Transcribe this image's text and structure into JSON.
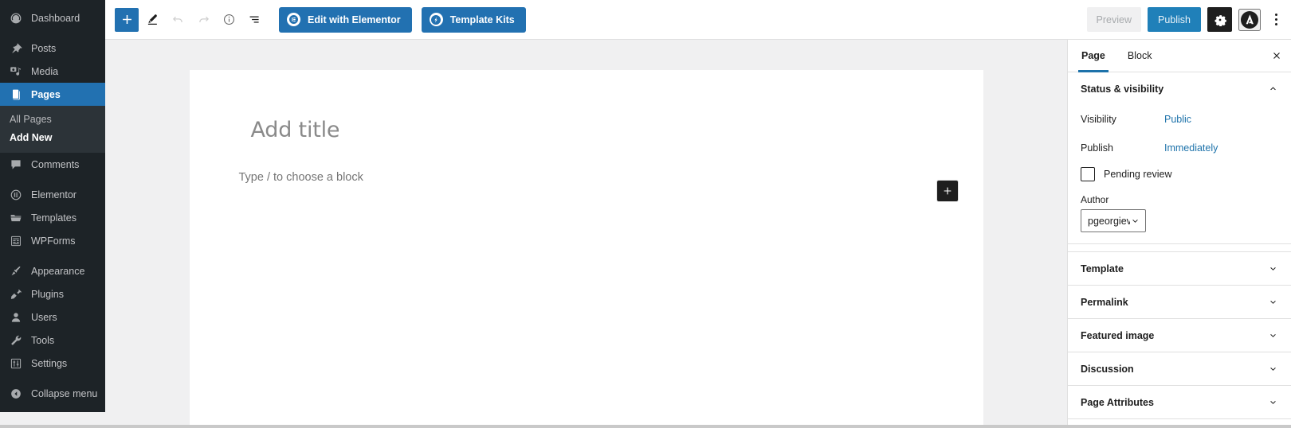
{
  "admin_menu": {
    "items": [
      {
        "label": "Dashboard",
        "icon": "dashboard-icon",
        "current": false,
        "sep_after": true
      },
      {
        "label": "Posts",
        "icon": "pin-icon",
        "current": false,
        "sep_after": false
      },
      {
        "label": "Media",
        "icon": "media-icon",
        "current": false,
        "sep_after": false
      },
      {
        "label": "Pages",
        "icon": "pages-icon",
        "current": true,
        "sep_after": false
      },
      {
        "label": "Comments",
        "icon": "comments-icon",
        "current": false,
        "sep_after": true
      },
      {
        "label": "Elementor",
        "icon": "elementor-icon",
        "current": false,
        "sep_after": false
      },
      {
        "label": "Templates",
        "icon": "folder-icon",
        "current": false,
        "sep_after": false
      },
      {
        "label": "WPForms",
        "icon": "wpforms-icon",
        "current": false,
        "sep_after": true
      },
      {
        "label": "Appearance",
        "icon": "brush-icon",
        "current": false,
        "sep_after": false
      },
      {
        "label": "Plugins",
        "icon": "plug-icon",
        "current": false,
        "sep_after": false
      },
      {
        "label": "Users",
        "icon": "user-icon",
        "current": false,
        "sep_after": false
      },
      {
        "label": "Tools",
        "icon": "wrench-icon",
        "current": false,
        "sep_after": false
      },
      {
        "label": "Settings",
        "icon": "sliders-icon",
        "current": false,
        "sep_after": true
      },
      {
        "label": "Collapse menu",
        "icon": "collapse-icon",
        "current": false,
        "sep_after": false
      }
    ],
    "submenu": [
      {
        "label": "All Pages",
        "current": false
      },
      {
        "label": "Add New",
        "current": true
      }
    ],
    "accent": "#2271b1",
    "background": "#1d2327"
  },
  "toolbar": {
    "add_block_label": "+",
    "tools": [
      {
        "name": "add-block-button",
        "icon": "plus-icon",
        "state": "primary"
      },
      {
        "name": "edit-tool-button",
        "icon": "pencil-icon",
        "state": "normal"
      },
      {
        "name": "undo-button",
        "icon": "undo-icon",
        "state": "disabled"
      },
      {
        "name": "redo-button",
        "icon": "redo-icon",
        "state": "disabled"
      },
      {
        "name": "details-button",
        "icon": "info-icon",
        "state": "normal"
      },
      {
        "name": "list-view-button",
        "icon": "list-view-icon",
        "state": "normal"
      }
    ],
    "elementor_button": "Edit with Elementor",
    "template_kits_button": "Template Kits",
    "preview_button": "Preview",
    "publish_button": "Publish",
    "settings_icon": "gear-icon",
    "envato_icon": "envato-logo-icon",
    "options_icon": "kebab-menu-icon",
    "primary_color": "#2271b1",
    "publish_color": "#2080b9"
  },
  "canvas": {
    "title_placeholder": "Add title",
    "paragraph_placeholder": "Type / to choose a block",
    "appender_icon": "plus-icon"
  },
  "settings_sidebar": {
    "tabs": [
      {
        "label": "Page",
        "active": true
      },
      {
        "label": "Block",
        "active": false
      }
    ],
    "close_icon": "close-icon",
    "status_section": {
      "title": "Status & visibility",
      "rows": [
        {
          "label": "Visibility",
          "value": "Public"
        },
        {
          "label": "Publish",
          "value": "Immediately"
        }
      ],
      "pending_review_label": "Pending review",
      "pending_review_checked": false,
      "author_label": "Author",
      "author_value": "pgeorgiev"
    },
    "sections": [
      {
        "title": "Template"
      },
      {
        "title": "Permalink"
      },
      {
        "title": "Featured image"
      },
      {
        "title": "Discussion"
      },
      {
        "title": "Page Attributes"
      }
    ],
    "link_color": "#1d72aa"
  }
}
